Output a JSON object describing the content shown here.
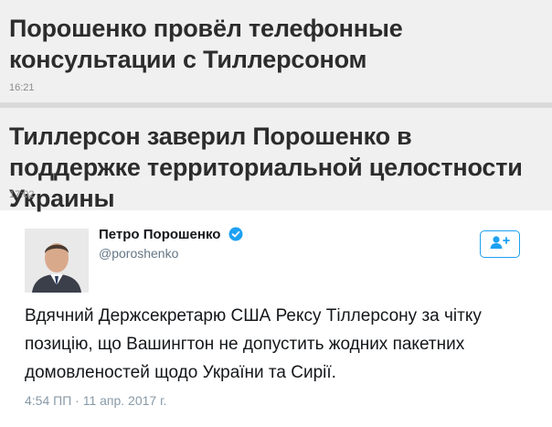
{
  "news": [
    {
      "title": "Порошенко провёл телефонные консультации с Тиллерсоном",
      "time": "16:21"
    },
    {
      "title": "Тиллерсон заверил Порошенко в поддержке территориальной целостности Украины",
      "time": "17:02"
    }
  ],
  "tweet": {
    "author_name": "Петро Порошенко",
    "handle": "@poroshenko",
    "text": "Вдячний Держсекретарю США Рексу Тіллерсону за чітку позицію, що Вашингтон не допустить жодних пакетних домовленостей щодо України та Сирії.",
    "timestamp": "4:54 ПП · 11 апр. 2017 г.",
    "follow_icon": "follow-user-icon",
    "verified_icon": "verified-badge-icon"
  },
  "colors": {
    "accent": "#1da1f2",
    "news_bg": "#f0f0f0",
    "separator": "#dadada"
  }
}
